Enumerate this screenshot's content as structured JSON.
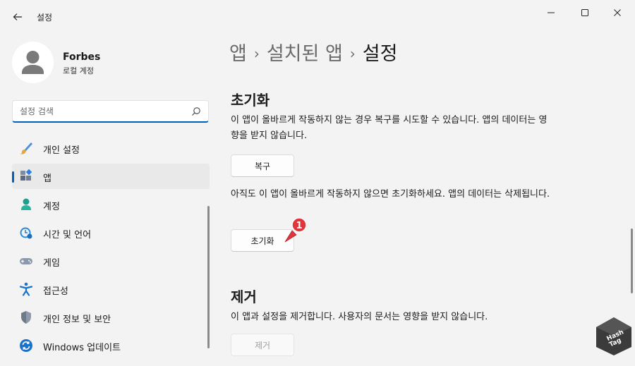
{
  "window": {
    "title": "설정",
    "controls": [
      "minimize-icon",
      "maximize-icon",
      "close-icon"
    ]
  },
  "profile": {
    "name": "Forbes",
    "subtitle": "로컬 계정"
  },
  "search": {
    "placeholder": "설정 검색"
  },
  "sidebar": {
    "items": [
      {
        "label": "개인 설정",
        "icon": "brush-icon"
      },
      {
        "label": "앱",
        "icon": "apps-icon",
        "active": true
      },
      {
        "label": "계정",
        "icon": "account-icon"
      },
      {
        "label": "시간 및 언어",
        "icon": "time-language-icon"
      },
      {
        "label": "게임",
        "icon": "gamepad-icon"
      },
      {
        "label": "접근성",
        "icon": "accessibility-icon"
      },
      {
        "label": "개인 정보 및 보안",
        "icon": "shield-icon"
      },
      {
        "label": "Windows 업데이트",
        "icon": "windows-update-icon"
      }
    ]
  },
  "breadcrumb": {
    "items": [
      "앱",
      "설치된 앱",
      "설정"
    ],
    "separator": "›"
  },
  "reset_section": {
    "title": "초기화",
    "repair_desc": "이 앱이 올바르게 작동하지 않는 경우 복구를 시도할 수 있습니다. 앱의 데이터는 영향을 받지 않습니다.",
    "repair_button": "복구",
    "reset_desc": "아직도 이 앱이 올바르게 작동하지 않으면 초기화하세요. 앱의 데이터는 삭제됩니다.",
    "reset_button": "초기화",
    "marker": "1"
  },
  "uninstall_section": {
    "title": "제거",
    "desc": "이 앱과 설정을 제거합니다. 사용자의 문서는 영향을 받지 않습니다.",
    "button": "제거",
    "button_disabled": true
  },
  "watermark": {
    "text_line1": "Hash",
    "text_line2": "Tag"
  },
  "colors": {
    "accent": "#005fb8",
    "background": "#f3f3f3",
    "marker_red": "#e0353b"
  }
}
